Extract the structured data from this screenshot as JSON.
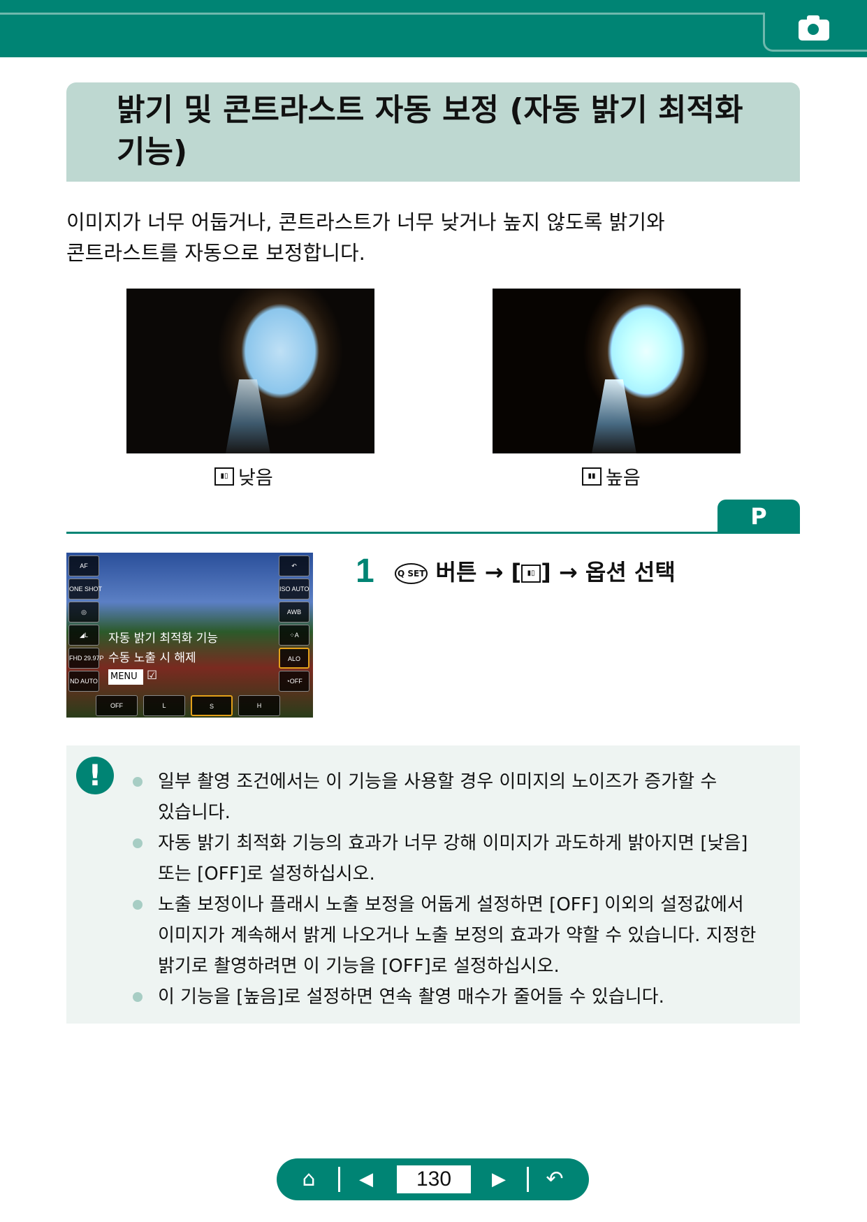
{
  "header": {
    "icon": "camera-icon",
    "accent": "#008474"
  },
  "title": "밝기 및 콘트라스트 자동 보정 (자동 밝기 최적화 기능)",
  "intro": "이미지가 너무 어둡거나, 콘트라스트가 너무 낮거나 높지 않도록 밝기와 콘트라스트를 자동으로 보정합니다.",
  "examples": [
    {
      "caption": "낮음",
      "icon": "alo-low-icon"
    },
    {
      "caption": "높음",
      "icon": "alo-high-icon"
    }
  ],
  "mode_tab": "P",
  "screen": {
    "left_buttons": [
      "AF",
      "ONE SHOT",
      "◎",
      "◢L",
      "FHD 29.97P",
      "ND AUTO"
    ],
    "right_buttons": [
      "↶",
      "ISO AUTO",
      "AWB",
      "⁘A",
      "ALO",
      "◔OFF"
    ],
    "bottom_buttons": [
      "OFF",
      "L",
      "S",
      "H"
    ],
    "option_label": "자동 밝기 최적화 기능",
    "option_sub": "수동 노출 시 해제",
    "menu_label": "MENU",
    "check": "☑"
  },
  "step": {
    "number": "1",
    "q_icon": "Q SET",
    "text_a": "버튼",
    "arrow": "→",
    "text_b": "옵션 선택"
  },
  "notes": [
    "일부 촬영 조건에서는 이 기능을 사용할 경우 이미지의 노이즈가 증가할 수 있습니다.",
    "자동 밝기 최적화 기능의 효과가 너무 강해 이미지가 과도하게 밝아지면 [낮음] 또는 [OFF]로 설정하십시오.",
    "노출 보정이나 플래시 노출 보정을 어둡게 설정하면 [OFF] 이외의 설정값에서 이미지가 계속해서 밝게 나오거나 노출 보정의 효과가 약할 수 있습니다. 지정한 밝기로 촬영하려면 이 기능을 [OFF]로 설정하십시오.",
    "이 기능을 [높음]로 설정하면 연속 촬영 매수가 줄어들 수 있습니다."
  ],
  "nav": {
    "home": "⌂",
    "prev": "◀",
    "page": "130",
    "next": "▶",
    "back": "↶"
  }
}
